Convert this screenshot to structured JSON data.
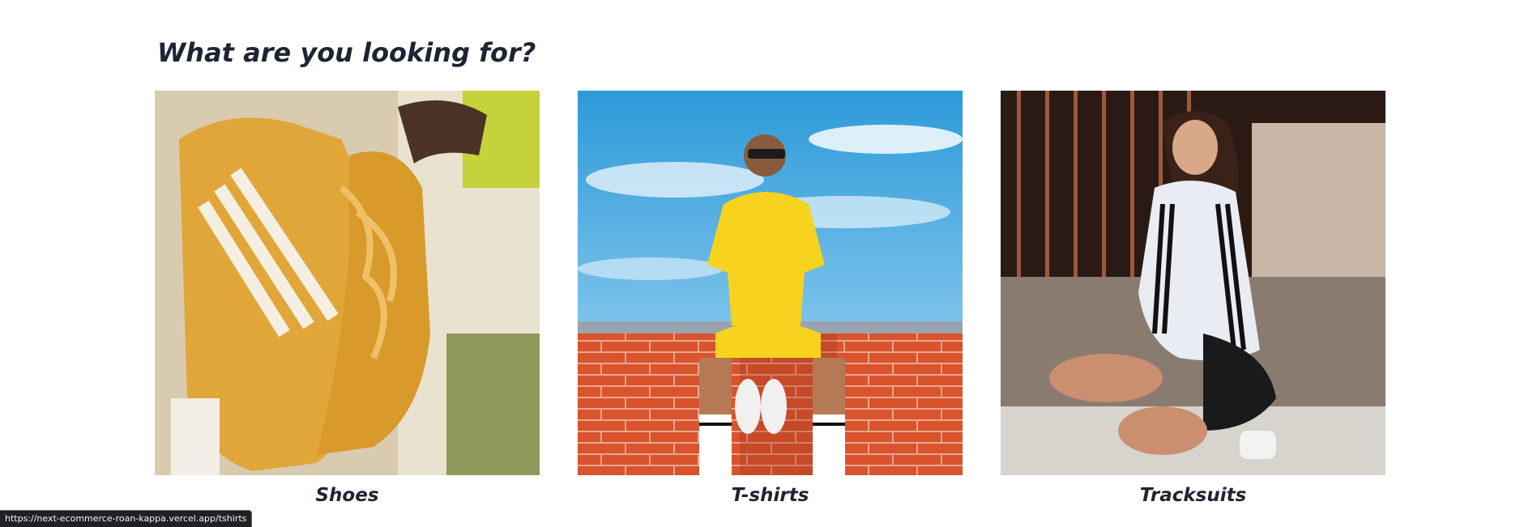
{
  "section": {
    "title": "What are you looking for?"
  },
  "categories": [
    {
      "label": "Shoes",
      "image": "yellow-sneakers-photo"
    },
    {
      "label": "T-shirts",
      "image": "man-in-yellow-tshirt-photo"
    },
    {
      "label": "Tracksuits",
      "image": "woman-in-white-tracksuit-photo"
    }
  ],
  "status_bar": {
    "url": "https://next-ecommerce-roan-kappa.vercel.app/tshirts"
  },
  "colors": {
    "text": "#1f2433",
    "background": "#ffffff",
    "status_bg": "#202124"
  }
}
